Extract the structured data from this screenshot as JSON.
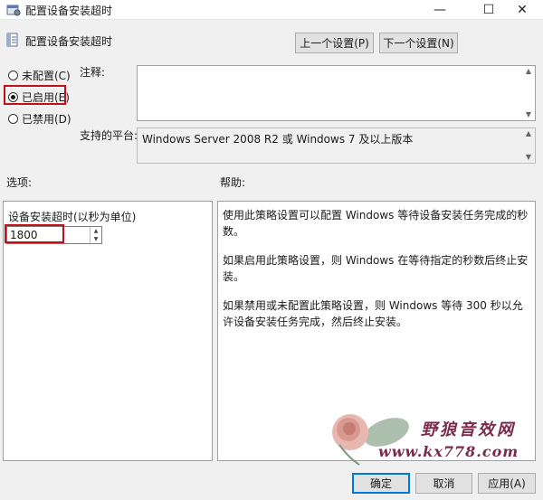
{
  "window": {
    "title": "配置设备安装超时",
    "icons": {
      "app": "policy-settings-icon",
      "minimize": "minimize-icon",
      "maximize": "maximize-icon",
      "close": "close-icon"
    }
  },
  "header": {
    "policy_name": "配置设备安装超时",
    "prev_label": "上一个设置(P)",
    "next_label": "下一个设置(N)"
  },
  "state": {
    "options": [
      {
        "label": "未配置(C)",
        "checked": false
      },
      {
        "label": "已启用(E)",
        "checked": true
      },
      {
        "label": "已禁用(D)",
        "checked": false
      }
    ],
    "highlight_color": "#c0101a"
  },
  "comment": {
    "label": "注释:",
    "value": ""
  },
  "platform": {
    "label": "支持的平台:",
    "value": "Windows Server 2008 R2 或 Windows 7 及以上版本"
  },
  "options_panel": {
    "section_label": "选项:",
    "field_label": "设备安装超时(以秒为单位)",
    "field_value": "1800"
  },
  "help_panel": {
    "section_label": "帮助:",
    "paragraphs": [
      "使用此策略设置可以配置 Windows 等待设备安装任务完成的秒数。",
      "如果启用此策略设置，则 Windows 在等待指定的秒数后终止安装。",
      "如果禁用或未配置此策略设置，则 Windows 等待 300 秒以允许设备安装任务完成，然后终止安装。"
    ]
  },
  "buttons": {
    "ok": "确定",
    "cancel": "取消",
    "apply": "应用(A)"
  },
  "watermark": {
    "text": "野狼音效网",
    "url": "www.kx778.com"
  }
}
